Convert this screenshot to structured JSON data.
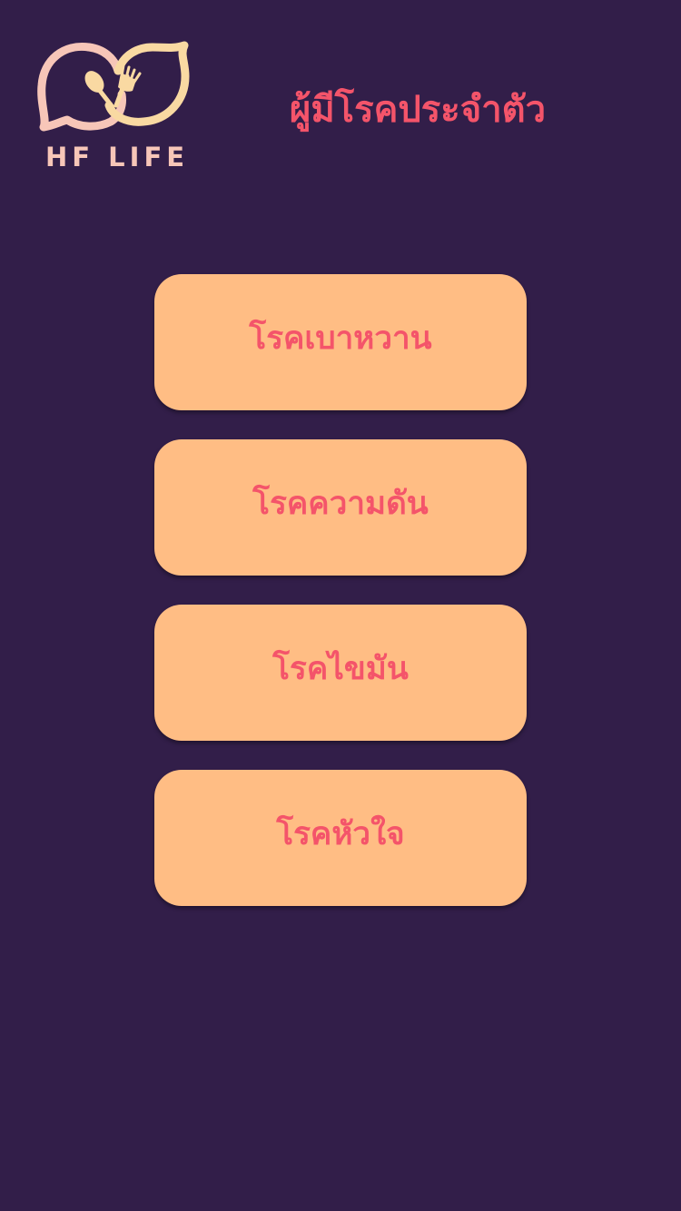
{
  "app": {
    "logo_text": "HF LIFE",
    "title": "ผู้มีโรคประจำตัว"
  },
  "menu": {
    "items": [
      {
        "label": "โรคเบาหวาน"
      },
      {
        "label": "โรคความดัน"
      },
      {
        "label": "โรคไขมัน"
      },
      {
        "label": "โรคหัวใจ"
      }
    ]
  },
  "colors": {
    "background": "#321e49",
    "button": "#ffbd84",
    "text_accent": "#f4546a",
    "logo": "#f7c6b8",
    "logo_gold": "#f9d9a2"
  },
  "icons": {
    "logo": "chat-bubbles-spoon-fork-icon"
  }
}
